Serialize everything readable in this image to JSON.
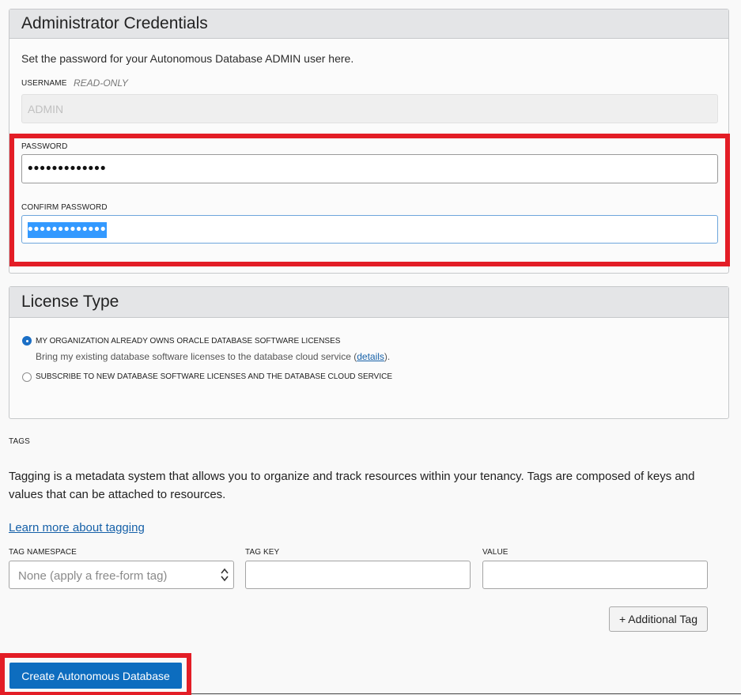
{
  "admin": {
    "title": "Administrator Credentials",
    "intro": "Set the password for your Autonomous Database ADMIN user here.",
    "username_label": "USERNAME",
    "username_readonly": "READ-ONLY",
    "username_value": "ADMIN",
    "password_label": "PASSWORD",
    "password_value": "•••••••••••••",
    "confirm_label": "CONFIRM PASSWORD",
    "confirm_value": "•••••••••••••"
  },
  "license": {
    "title": "License Type",
    "option1_label": "MY ORGANIZATION ALREADY OWNS ORACLE DATABASE SOFTWARE LICENSES",
    "option1_desc_prefix": "Bring my existing database software licenses to the database cloud service (",
    "option1_desc_link": "details",
    "option1_desc_suffix": ").",
    "option2_label": "SUBSCRIBE TO NEW DATABASE SOFTWARE LICENSES AND THE DATABASE CLOUD SERVICE",
    "selected": "option1"
  },
  "tags": {
    "heading": "TAGS",
    "description": "Tagging is a metadata system that allows you to organize and track resources within your tenancy. Tags are composed of keys and values that can be attached to resources.",
    "learn_more": "Learn more about tagging",
    "namespace_label": "TAG NAMESPACE",
    "namespace_value": "None (apply a free-form tag)",
    "key_label": "TAG KEY",
    "value_label": "VALUE",
    "add_tag": "+ Additional Tag"
  },
  "actions": {
    "create": "Create Autonomous Database"
  },
  "colors": {
    "highlight": "#e31d26",
    "primary": "#0d6dbf",
    "link": "#1560a8"
  }
}
